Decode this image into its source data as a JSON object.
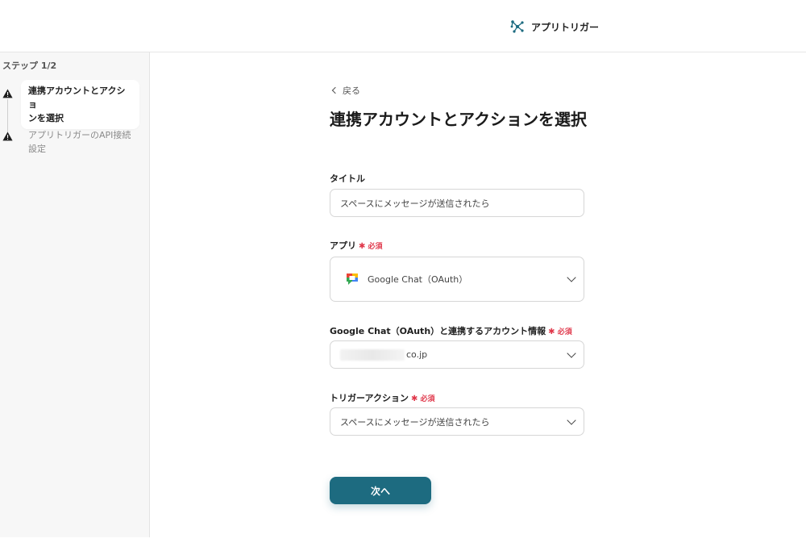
{
  "header": {
    "brand_name": "アプリトリガー",
    "brand_icon": "network-nodes-icon",
    "brand_color": "#1d6b80"
  },
  "sidebar": {
    "step_count": "ステップ 1/2",
    "steps": [
      {
        "line1": "連携アカウントとアクショ",
        "line2": "ンを選択",
        "status": "warning",
        "active": true
      },
      {
        "line1": "アプリトリガーのAPI接続",
        "line2": "設定",
        "status": "warning",
        "active": false
      }
    ]
  },
  "main": {
    "back_label": "戻る",
    "title": "連携アカウントとアクションを選択",
    "fields": {
      "title": {
        "label": "タイトル",
        "value": "スペースにメッセージが送信されたら"
      },
      "app": {
        "label": "アプリ",
        "required": "必須",
        "value": "Google Chat（OAuth）",
        "icon": "google-chat-icon"
      },
      "account": {
        "label": "Google Chat（OAuth）と連携するアカウント情報",
        "required": "必須",
        "value_suffix": "co.jp"
      },
      "trigger": {
        "label": "トリガーアクション",
        "required": "必須",
        "value": "スペースにメッセージが送信されたら"
      }
    },
    "next_label": "次へ"
  },
  "colors": {
    "primary": "#1d6b80",
    "required": "#e0384b",
    "warning": "#1f1f1f"
  }
}
